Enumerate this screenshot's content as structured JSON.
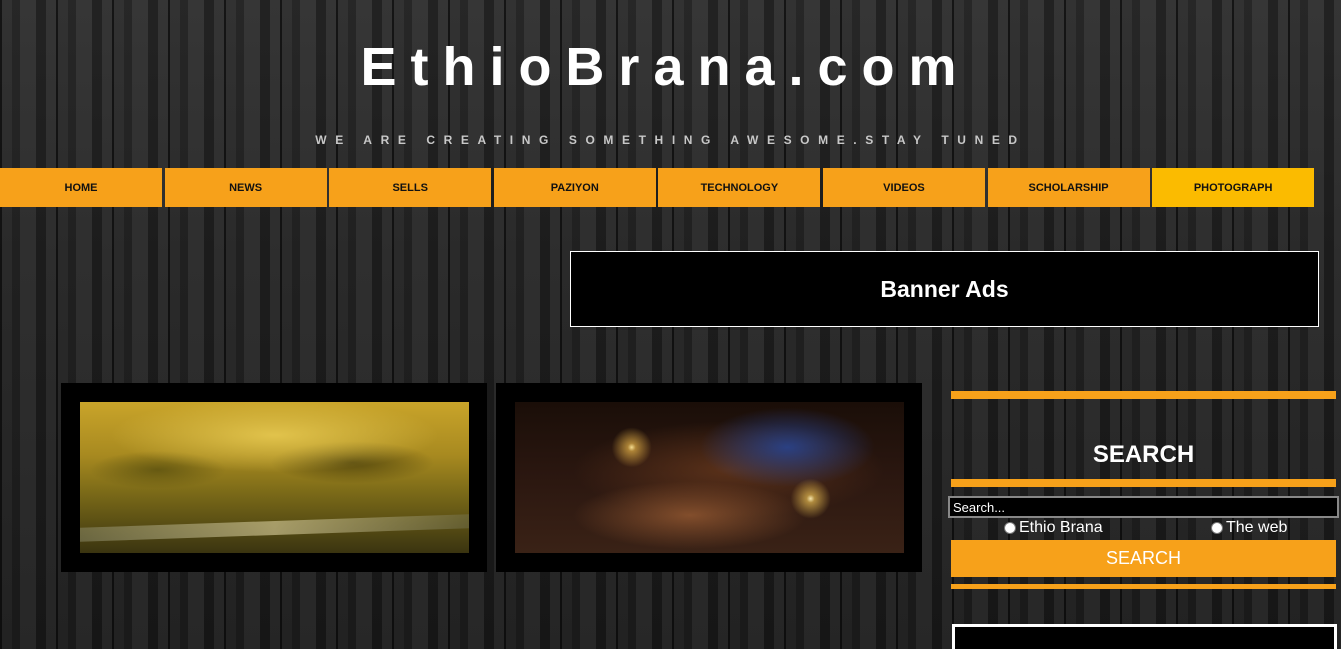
{
  "header": {
    "title": "EthioBrana.com",
    "tagline": "WE ARE CREATING SOMETHING AWESOME.STAY TUNED"
  },
  "nav": {
    "items": [
      {
        "label": "HOME"
      },
      {
        "label": "NEWS"
      },
      {
        "label": "SELLS"
      },
      {
        "label": "PAZIYON"
      },
      {
        "label": "TECHNOLOGY"
      },
      {
        "label": "VIDEOS"
      },
      {
        "label": "SCHOLARSHIP"
      },
      {
        "label": "PHOTOGRAPH",
        "active": true
      }
    ]
  },
  "banner": {
    "label": "Banner Ads"
  },
  "sidebar": {
    "search_heading": "SEARCH",
    "search_placeholder": "Search...",
    "radio_options": [
      "Ethio Brana",
      "The web"
    ],
    "search_button": "SEARCH"
  },
  "colors": {
    "accent": "#f7a11a",
    "accent_active": "#fbbb00",
    "background": "#1c1c1c"
  }
}
